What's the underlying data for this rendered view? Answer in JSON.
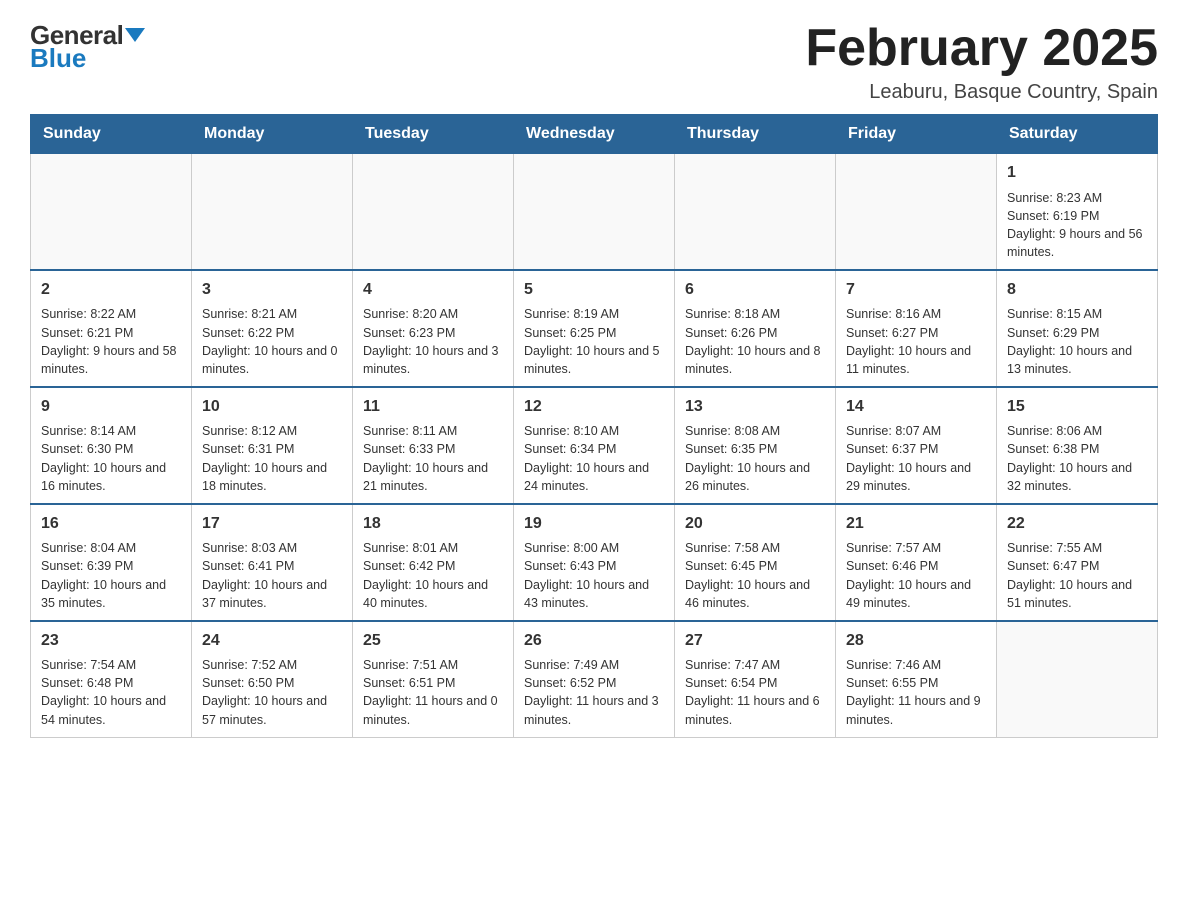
{
  "logo": {
    "general": "General",
    "blue": "Blue"
  },
  "title": "February 2025",
  "location": "Leaburu, Basque Country, Spain",
  "days_header": [
    "Sunday",
    "Monday",
    "Tuesday",
    "Wednesday",
    "Thursday",
    "Friday",
    "Saturday"
  ],
  "weeks": [
    [
      {
        "day": "",
        "info": ""
      },
      {
        "day": "",
        "info": ""
      },
      {
        "day": "",
        "info": ""
      },
      {
        "day": "",
        "info": ""
      },
      {
        "day": "",
        "info": ""
      },
      {
        "day": "",
        "info": ""
      },
      {
        "day": "1",
        "info": "Sunrise: 8:23 AM\nSunset: 6:19 PM\nDaylight: 9 hours and 56 minutes."
      }
    ],
    [
      {
        "day": "2",
        "info": "Sunrise: 8:22 AM\nSunset: 6:21 PM\nDaylight: 9 hours and 58 minutes."
      },
      {
        "day": "3",
        "info": "Sunrise: 8:21 AM\nSunset: 6:22 PM\nDaylight: 10 hours and 0 minutes."
      },
      {
        "day": "4",
        "info": "Sunrise: 8:20 AM\nSunset: 6:23 PM\nDaylight: 10 hours and 3 minutes."
      },
      {
        "day": "5",
        "info": "Sunrise: 8:19 AM\nSunset: 6:25 PM\nDaylight: 10 hours and 5 minutes."
      },
      {
        "day": "6",
        "info": "Sunrise: 8:18 AM\nSunset: 6:26 PM\nDaylight: 10 hours and 8 minutes."
      },
      {
        "day": "7",
        "info": "Sunrise: 8:16 AM\nSunset: 6:27 PM\nDaylight: 10 hours and 11 minutes."
      },
      {
        "day": "8",
        "info": "Sunrise: 8:15 AM\nSunset: 6:29 PM\nDaylight: 10 hours and 13 minutes."
      }
    ],
    [
      {
        "day": "9",
        "info": "Sunrise: 8:14 AM\nSunset: 6:30 PM\nDaylight: 10 hours and 16 minutes."
      },
      {
        "day": "10",
        "info": "Sunrise: 8:12 AM\nSunset: 6:31 PM\nDaylight: 10 hours and 18 minutes."
      },
      {
        "day": "11",
        "info": "Sunrise: 8:11 AM\nSunset: 6:33 PM\nDaylight: 10 hours and 21 minutes."
      },
      {
        "day": "12",
        "info": "Sunrise: 8:10 AM\nSunset: 6:34 PM\nDaylight: 10 hours and 24 minutes."
      },
      {
        "day": "13",
        "info": "Sunrise: 8:08 AM\nSunset: 6:35 PM\nDaylight: 10 hours and 26 minutes."
      },
      {
        "day": "14",
        "info": "Sunrise: 8:07 AM\nSunset: 6:37 PM\nDaylight: 10 hours and 29 minutes."
      },
      {
        "day": "15",
        "info": "Sunrise: 8:06 AM\nSunset: 6:38 PM\nDaylight: 10 hours and 32 minutes."
      }
    ],
    [
      {
        "day": "16",
        "info": "Sunrise: 8:04 AM\nSunset: 6:39 PM\nDaylight: 10 hours and 35 minutes."
      },
      {
        "day": "17",
        "info": "Sunrise: 8:03 AM\nSunset: 6:41 PM\nDaylight: 10 hours and 37 minutes."
      },
      {
        "day": "18",
        "info": "Sunrise: 8:01 AM\nSunset: 6:42 PM\nDaylight: 10 hours and 40 minutes."
      },
      {
        "day": "19",
        "info": "Sunrise: 8:00 AM\nSunset: 6:43 PM\nDaylight: 10 hours and 43 minutes."
      },
      {
        "day": "20",
        "info": "Sunrise: 7:58 AM\nSunset: 6:45 PM\nDaylight: 10 hours and 46 minutes."
      },
      {
        "day": "21",
        "info": "Sunrise: 7:57 AM\nSunset: 6:46 PM\nDaylight: 10 hours and 49 minutes."
      },
      {
        "day": "22",
        "info": "Sunrise: 7:55 AM\nSunset: 6:47 PM\nDaylight: 10 hours and 51 minutes."
      }
    ],
    [
      {
        "day": "23",
        "info": "Sunrise: 7:54 AM\nSunset: 6:48 PM\nDaylight: 10 hours and 54 minutes."
      },
      {
        "day": "24",
        "info": "Sunrise: 7:52 AM\nSunset: 6:50 PM\nDaylight: 10 hours and 57 minutes."
      },
      {
        "day": "25",
        "info": "Sunrise: 7:51 AM\nSunset: 6:51 PM\nDaylight: 11 hours and 0 minutes."
      },
      {
        "day": "26",
        "info": "Sunrise: 7:49 AM\nSunset: 6:52 PM\nDaylight: 11 hours and 3 minutes."
      },
      {
        "day": "27",
        "info": "Sunrise: 7:47 AM\nSunset: 6:54 PM\nDaylight: 11 hours and 6 minutes."
      },
      {
        "day": "28",
        "info": "Sunrise: 7:46 AM\nSunset: 6:55 PM\nDaylight: 11 hours and 9 minutes."
      },
      {
        "day": "",
        "info": ""
      }
    ]
  ]
}
